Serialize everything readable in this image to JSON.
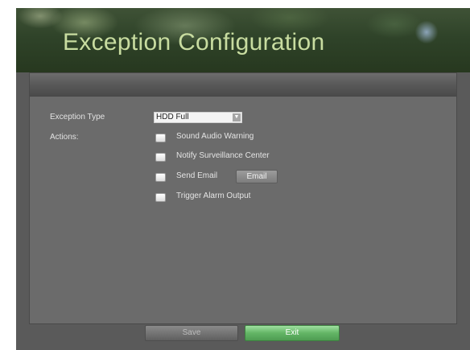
{
  "window": {
    "title": "Exception Configuration"
  },
  "form": {
    "exception_type_label": "Exception Type",
    "exception_type_value": "HDD Full",
    "actions_label": "Actions:",
    "actions": [
      {
        "label": "Sound Audio Warning",
        "checked": false
      },
      {
        "label": "Notify Surveillance Center",
        "checked": false
      },
      {
        "label": "Send Email",
        "checked": false
      },
      {
        "label": "Trigger Alarm Output",
        "checked": false
      }
    ],
    "email_button_label": "Email"
  },
  "footer": {
    "save_label": "Save",
    "exit_label": "Exit"
  },
  "colors": {
    "title": "#c8dca0",
    "background": "#5a5a5a",
    "panel": "#6b6b6b",
    "exit_button": "#63b565"
  },
  "icons": {
    "select_arrow": "dropdown-arrow-icon"
  }
}
